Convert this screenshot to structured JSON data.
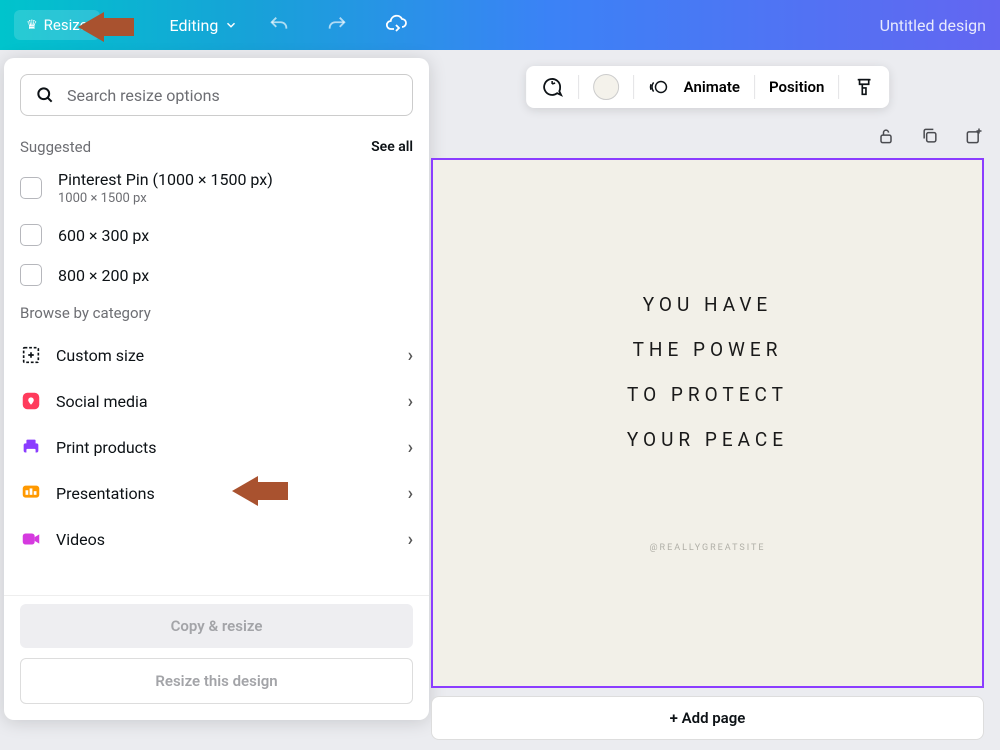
{
  "topbar": {
    "resize_label": "Resize",
    "editing_label": "Editing",
    "doc_title": "Untitled design"
  },
  "search": {
    "placeholder": "Search resize options"
  },
  "suggested": {
    "label": "Suggested",
    "see_all": "See all",
    "items": [
      {
        "title": "Pinterest Pin (1000 × 1500 px)",
        "sub": "1000 × 1500 px"
      },
      {
        "title": "600 × 300 px",
        "sub": ""
      },
      {
        "title": "800 × 200 px",
        "sub": ""
      }
    ]
  },
  "browse": {
    "label": "Browse by category",
    "items": [
      {
        "label": "Custom size",
        "color": "#0d1216"
      },
      {
        "label": "Social media",
        "color": "#ff3b5c"
      },
      {
        "label": "Print products",
        "color": "#8b3dff"
      },
      {
        "label": "Presentations",
        "color": "#ff9900"
      },
      {
        "label": "Videos",
        "color": "#d53adf"
      }
    ]
  },
  "footer": {
    "copy_resize": "Copy & resize",
    "resize_design": "Resize this design"
  },
  "toolbar": {
    "animate": "Animate",
    "position": "Position"
  },
  "canvas": {
    "line1": "YOU HAVE",
    "line2": "THE POWER",
    "line3": "TO PROTECT",
    "line4": "YOUR PEACE",
    "handle": "@REALLYGREATSITE"
  },
  "add_page": "+ Add page"
}
